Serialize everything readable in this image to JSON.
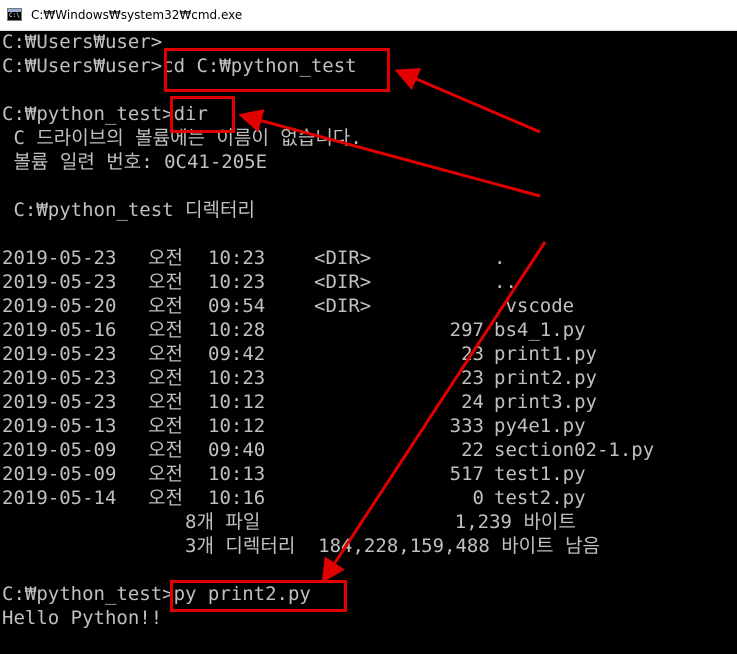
{
  "window": {
    "title": "C:₩Windows₩system32₩cmd.exe",
    "icon": "cmd-icon"
  },
  "console": {
    "lines": [
      "C:₩Users₩user>",
      "C:₩Users₩user>cd C:₩python_test",
      "",
      "C:₩python_test>dir",
      " C 드라이브의 볼륨에는 이름이 없습니다.",
      " 볼륨 일련 번호: 0C41-205E",
      "",
      " C:₩python_test 디렉터리",
      "",
      "",
      "",
      "",
      "",
      "",
      "",
      "",
      "",
      "",
      "",
      "",
      "",
      "                8개 파일                 1,239 바이트",
      "                3개 디렉터리  184,228,159,488 바이트 남음",
      "",
      "C:₩python_test>py print2.py",
      "Hello Python!!"
    ],
    "dir_listing": [
      {
        "date": "2019-05-23",
        "ampm": "오전",
        "time": "10:23",
        "dir": "<DIR>",
        "size": "",
        "name": "."
      },
      {
        "date": "2019-05-23",
        "ampm": "오전",
        "time": "10:23",
        "dir": "<DIR>",
        "size": "",
        "name": ".."
      },
      {
        "date": "2019-05-20",
        "ampm": "오전",
        "time": "09:54",
        "dir": "<DIR>",
        "size": "",
        "name": ".vscode"
      },
      {
        "date": "2019-05-16",
        "ampm": "오전",
        "time": "10:28",
        "dir": "",
        "size": "297",
        "name": "bs4_1.py"
      },
      {
        "date": "2019-05-23",
        "ampm": "오전",
        "time": "09:42",
        "dir": "",
        "size": "23",
        "name": "print1.py"
      },
      {
        "date": "2019-05-23",
        "ampm": "오전",
        "time": "10:23",
        "dir": "",
        "size": "23",
        "name": "print2.py"
      },
      {
        "date": "2019-05-23",
        "ampm": "오전",
        "time": "10:12",
        "dir": "",
        "size": "24",
        "name": "print3.py"
      },
      {
        "date": "2019-05-13",
        "ampm": "오전",
        "time": "10:12",
        "dir": "",
        "size": "333",
        "name": "py4e1.py"
      },
      {
        "date": "2019-05-09",
        "ampm": "오전",
        "time": "09:40",
        "dir": "",
        "size": "22",
        "name": "section02-1.py"
      },
      {
        "date": "2019-05-09",
        "ampm": "오전",
        "time": "10:13",
        "dir": "",
        "size": "517",
        "name": "test1.py"
      },
      {
        "date": "2019-05-14",
        "ampm": "오전",
        "time": "10:16",
        "dir": "",
        "size": "0",
        "name": "test2.py"
      }
    ]
  },
  "colors": {
    "background": "#000000",
    "text": "#c0c0c0",
    "highlight": "#e00000"
  }
}
